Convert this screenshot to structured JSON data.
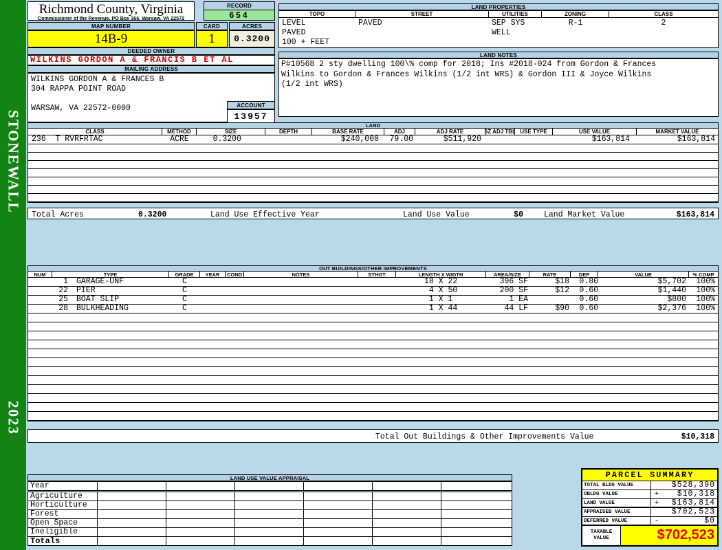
{
  "sidebar": {
    "district": "STONEWALL",
    "year": "2023"
  },
  "header": {
    "county": "Richmond County, Virginia",
    "sub": "Commissioner of the Revenue, PO Box 366, Warsaw, VA 22572",
    "record_label": "RECORD",
    "record_value": "654",
    "map_number_label": "MAP NUMBER",
    "map_number": "14B-9",
    "card_label": "CARD",
    "card": "1",
    "acres_label": "ACRES",
    "acres": "0.3200",
    "deeded_owner_label": "DEEDED OWNER",
    "deeded_owner": "WILKINS GORDON A & FRANCIS B ET AL",
    "mailing_address_label": "MAILING ADDRESS",
    "mailing_lines": [
      "WILKINS GORDON A & FRANCES B",
      "304 RAPPA POINT ROAD",
      "",
      "WARSAW, VA 22572-0000"
    ],
    "account_label": "ACCOUNT",
    "account": "13957"
  },
  "land_properties": {
    "title": "LAND PROPERTIES",
    "columns": [
      "TOPO",
      "STREET",
      "UTILITIES",
      "ZONING",
      "CLASS"
    ],
    "rows": [
      [
        "LEVEL",
        "PAVED",
        "SEP SYS",
        "R-1",
        "2"
      ],
      [
        "PAVED",
        "",
        "WELL",
        "",
        ""
      ],
      [
        "100 + FEET",
        "",
        "",
        "",
        ""
      ]
    ]
  },
  "land_notes": {
    "title": "LAND NOTES",
    "lines": [
      "P#10568 2 sty dwelling 100\\% comp for 2018; Ins #2018-024 from Gordon & Frances",
      "Wilkins to Gordon & Frances Wilkins (1/2 int WRS) & Gordon III & Joyce Wilkins",
      "(1/2 int WRS)"
    ]
  },
  "land": {
    "title": "LAND",
    "columns": [
      "CLASS",
      "METHOD",
      "SIZE",
      "DEPTH",
      "BASE RATE",
      "ADJ",
      "ADJ RATE",
      "SZ ADJ TBL",
      "USE TYPE",
      "USE VALUE",
      "MARKET VALUE"
    ],
    "rows": [
      [
        "236  T RVRFRTAC",
        "ACRE",
        "0.3200",
        "",
        "$240,000",
        "79.00",
        "$511,920",
        "",
        "",
        "$163,814",
        "$163,814"
      ]
    ],
    "empty_rows": 7,
    "total_acres_label": "Total Acres",
    "total_acres_value": "0.3200",
    "effective_year_label": "Land Use Effective Year",
    "use_value_label": "Land Use Value",
    "use_value": "$0",
    "market_value_label": "Land Market Value",
    "market_value": "$163,814"
  },
  "out_buildings": {
    "title": "OUT BUILDINGS/OTHER IMPROVEMENTS",
    "columns": [
      "NUM",
      "TYPE",
      "GRADE",
      "YEAR",
      "COND",
      "NOTES",
      "STHGT",
      "LENGTH X WIDTH",
      "AREA/SIZE",
      "RATE",
      "DEP",
      "VALUE",
      "% COMP"
    ],
    "rows": [
      [
        "1",
        "GARAGE-UNF",
        "C",
        "",
        "",
        "",
        "",
        "18 X 22",
        "396 SF",
        "$18",
        "0.80",
        "$5,702",
        "100%"
      ],
      [
        "22",
        "PIER",
        "C",
        "",
        "",
        "",
        "",
        " 4 X 50",
        "200 SF",
        "$12",
        "0.60",
        "$1,440",
        "100%"
      ],
      [
        "25",
        "BOAT SLIP",
        "C",
        "",
        "",
        "",
        "",
        " 1 X 1",
        "1 EA",
        "",
        "0.60",
        "$800",
        "100%"
      ],
      [
        "28",
        "BULKHEADING",
        "C",
        "",
        "",
        "",
        "",
        " 1 X 44",
        "44 LF",
        "$90",
        "0.60",
        "$2,376",
        "100%"
      ]
    ],
    "empty_rows": 12,
    "total_label": "Total Out Buildings & Other Improvements Value",
    "total_value": "$10,318"
  },
  "land_use_appraisal": {
    "title": "LAND USE VALUE APPRAISAL",
    "row_labels": [
      "Year",
      "Agriculture",
      "Horticulture",
      "Forest",
      "Open Space",
      "Ineligible",
      "Totals"
    ],
    "data_column_count": 6
  },
  "parcel_summary": {
    "title": "PARCEL SUMMARY",
    "rows": [
      {
        "label": "TOTAL BLDG VALUE",
        "op": "",
        "value": "$528,390"
      },
      {
        "label": "OBLDG VALUE",
        "op": "+",
        "value": "$10,318"
      },
      {
        "label": "LAND VALUE",
        "op": "+",
        "value": "$163,814"
      },
      {
        "label": "APPRAISED VALUE",
        "op": "",
        "value": "$702,523"
      },
      {
        "label": "DEFERRED VALUE",
        "op": "-",
        "value": "$0"
      }
    ],
    "taxable_label_lines": [
      "TAXABLE",
      "VALUE"
    ],
    "taxable_value": "$702,523"
  },
  "colors": {
    "page_blue": "#bad8e8",
    "header_blue": "#b5d3e4",
    "sidebar_green": "#138413",
    "record_green": "#99e699",
    "highlight_yellow": "#ffff00",
    "acres_cream": "#f0eede",
    "owner_red": "#cc0000",
    "taxable_red": "#e60000"
  }
}
